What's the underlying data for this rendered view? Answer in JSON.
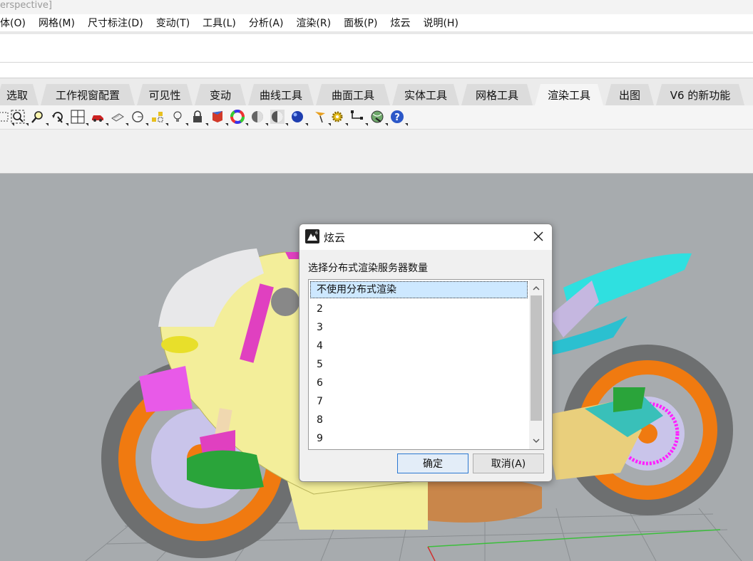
{
  "window": {
    "title_fragment": "erspective]"
  },
  "menu": [
    "体(O)",
    "网格(M)",
    "尺寸标注(D)",
    "变动(T)",
    "工具(L)",
    "分析(A)",
    "渲染(R)",
    "面板(P)",
    "炫云",
    "说明(H)"
  ],
  "tabs": [
    "选取",
    "工作视窗配置",
    "可见性",
    "变动",
    "曲线工具",
    "曲面工具",
    "实体工具",
    "网格工具",
    "渲染工具",
    "出图",
    "V6 的新功能"
  ],
  "toolbar_icons": [
    "select-window-icon",
    "zoom-window-icon",
    "zoom-selected-icon",
    "rotate-view-icon",
    "four-viewports-icon",
    "car-icon",
    "paper-icon",
    "circle-icon",
    "dots-icon",
    "light-bulb-icon",
    "lock-icon",
    "material-icon",
    "color-wheel-icon",
    "shaded-sphere-icon",
    "rendered-sphere-icon",
    "blue-sphere-icon",
    "flag-icon",
    "gear-icon",
    "dimension-icon",
    "globe-icon",
    "help-icon"
  ],
  "dialog": {
    "title": "炫云",
    "prompt": "选择分布式渲染服务器数量",
    "options": [
      "不使用分布式渲染",
      "2",
      "3",
      "4",
      "5",
      "6",
      "7",
      "8",
      "9"
    ],
    "selected": "不使用分布式渲染",
    "ok_label": "确定",
    "cancel_label": "取消(A)"
  },
  "colors": {
    "viewport_bg": "#a7abae",
    "selection": "#cde8ff",
    "primary_border": "#2b78d1"
  }
}
